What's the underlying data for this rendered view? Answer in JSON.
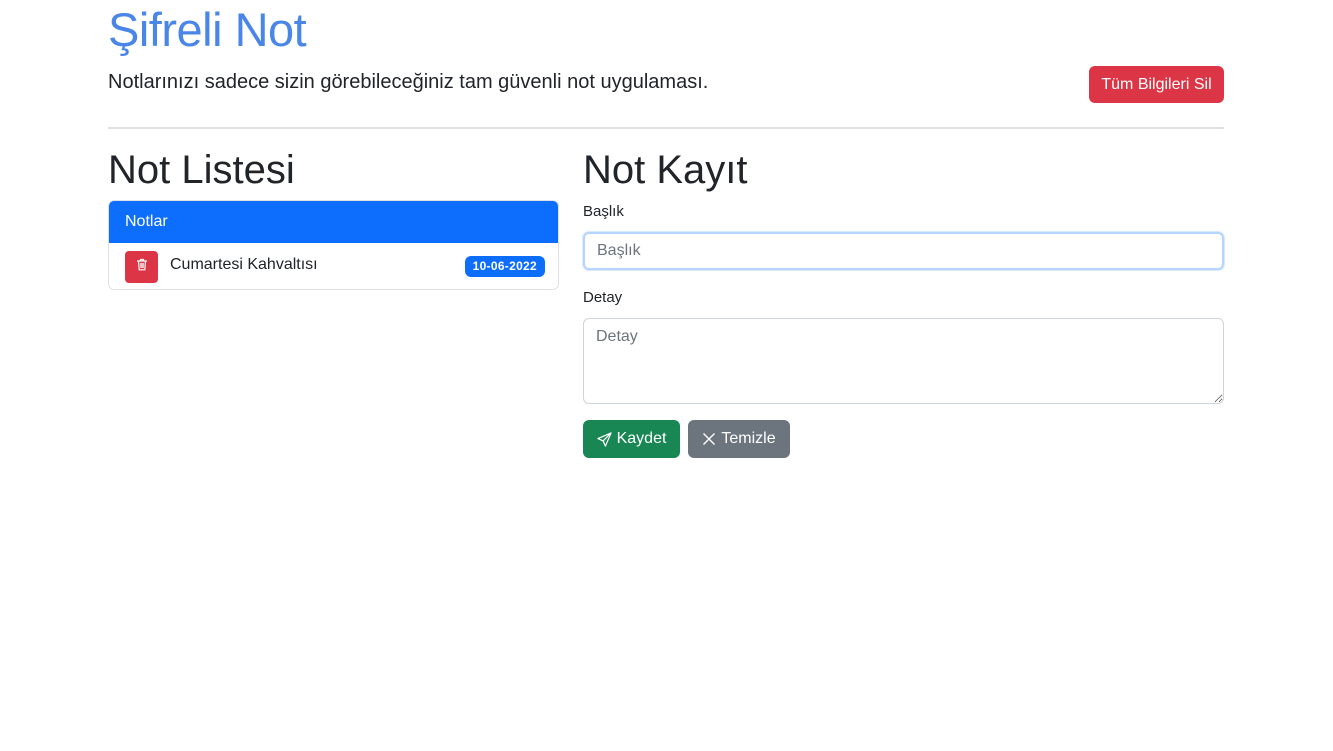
{
  "header": {
    "title": "Şifreli Not",
    "subtitle": "Notlarınızı sadece sizin görebileceğiniz tam güvenli not uygulaması.",
    "clear_all_label": "Tüm Bilgileri Sil"
  },
  "list": {
    "title": "Not Listesi",
    "header_label": "Notlar",
    "items": [
      {
        "title": "Cumartesi Kahvaltısı",
        "date": "10-06-2022",
        "delete_icon": "trash-icon"
      }
    ]
  },
  "form": {
    "title": "Not Kayıt",
    "title_label": "Başlık",
    "title_placeholder": "Başlık",
    "title_value": "",
    "detail_label": "Detay",
    "detail_placeholder": "Detay",
    "detail_value": "",
    "save_label": "Kaydet",
    "save_icon": "send-icon",
    "clear_label": "Temizle",
    "clear_icon": "close-icon"
  },
  "colors": {
    "title": "#4a86e8",
    "primary": "#0d6efd",
    "danger": "#dc3545",
    "success": "#198754",
    "secondary": "#6c757d"
  }
}
